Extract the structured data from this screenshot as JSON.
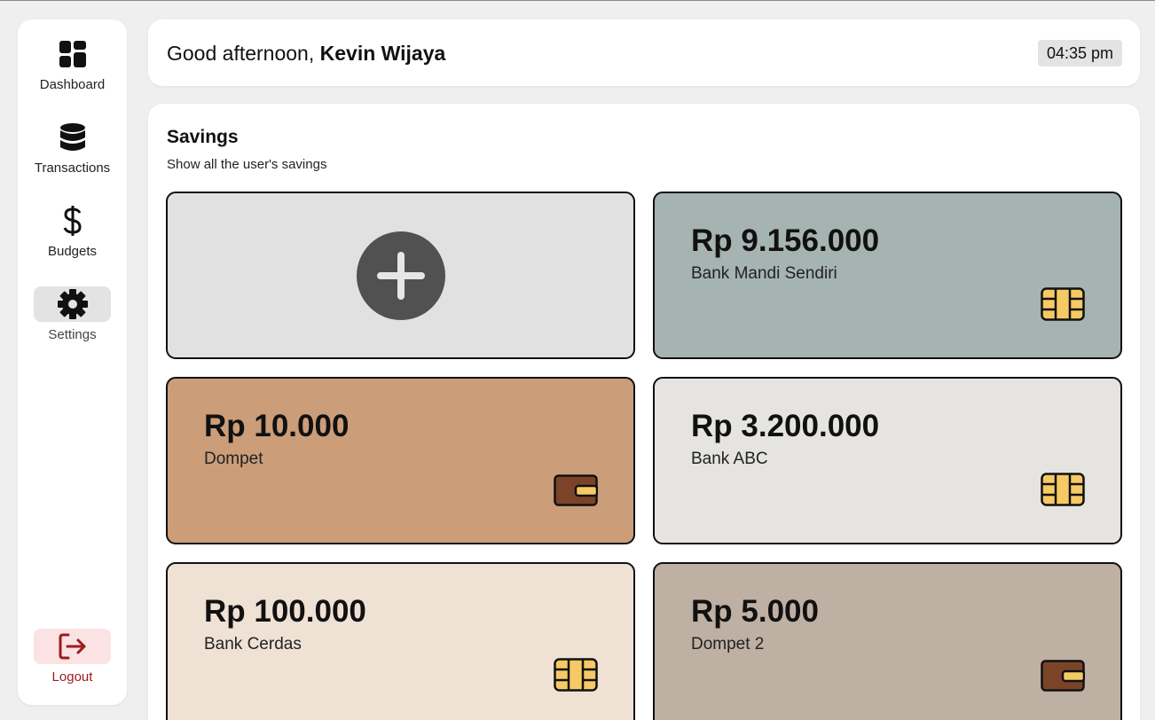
{
  "sidebar": {
    "items": [
      {
        "label": "Dashboard",
        "icon": "dashboard-grid-icon",
        "active": false
      },
      {
        "label": "Transactions",
        "icon": "database-icon",
        "active": false
      },
      {
        "label": "Budgets",
        "icon": "dollar-icon",
        "active": false
      },
      {
        "label": "Settings",
        "icon": "gear-icon",
        "active": true
      }
    ],
    "logout": {
      "label": "Logout",
      "icon": "logout-icon"
    }
  },
  "header": {
    "greeting_prefix": "Good afternoon, ",
    "user_name": "Kevin Wijaya",
    "time": "04:35 pm"
  },
  "savings": {
    "title": "Savings",
    "subtitle": "Show all the user's savings",
    "add_icon": "plus-icon",
    "cards": [
      {
        "amount": "Rp 9.156.000",
        "name": "Bank Mandi Sendiri",
        "type": "bank",
        "icon": "chip-card-icon",
        "color": "#a5b4b1"
      },
      {
        "amount": "Rp 10.000",
        "name": "Dompet",
        "type": "wallet",
        "icon": "wallet-icon",
        "color": "#cb9d79"
      },
      {
        "amount": "Rp 3.200.000",
        "name": "Bank ABC",
        "type": "bank",
        "icon": "chip-card-icon",
        "color": "#e5e4e0"
      },
      {
        "amount": "Rp 100.000",
        "name": "Bank Cerdas",
        "type": "bank",
        "icon": "chip-card-icon",
        "color": "#efe2d5"
      },
      {
        "amount": "Rp 5.000",
        "name": "Dompet 2",
        "type": "wallet",
        "icon": "wallet-icon",
        "color": "#bfb0a4"
      }
    ]
  },
  "colors": {
    "background": "#efefef",
    "active_nav": "#e3e3e3",
    "logout_bg": "#fbe2e3",
    "logout_text": "#9b1c20",
    "add_card_bg": "#e1e1e1",
    "add_button": "#515151",
    "chip": "#f5c964",
    "wallet": "#7b4428"
  }
}
